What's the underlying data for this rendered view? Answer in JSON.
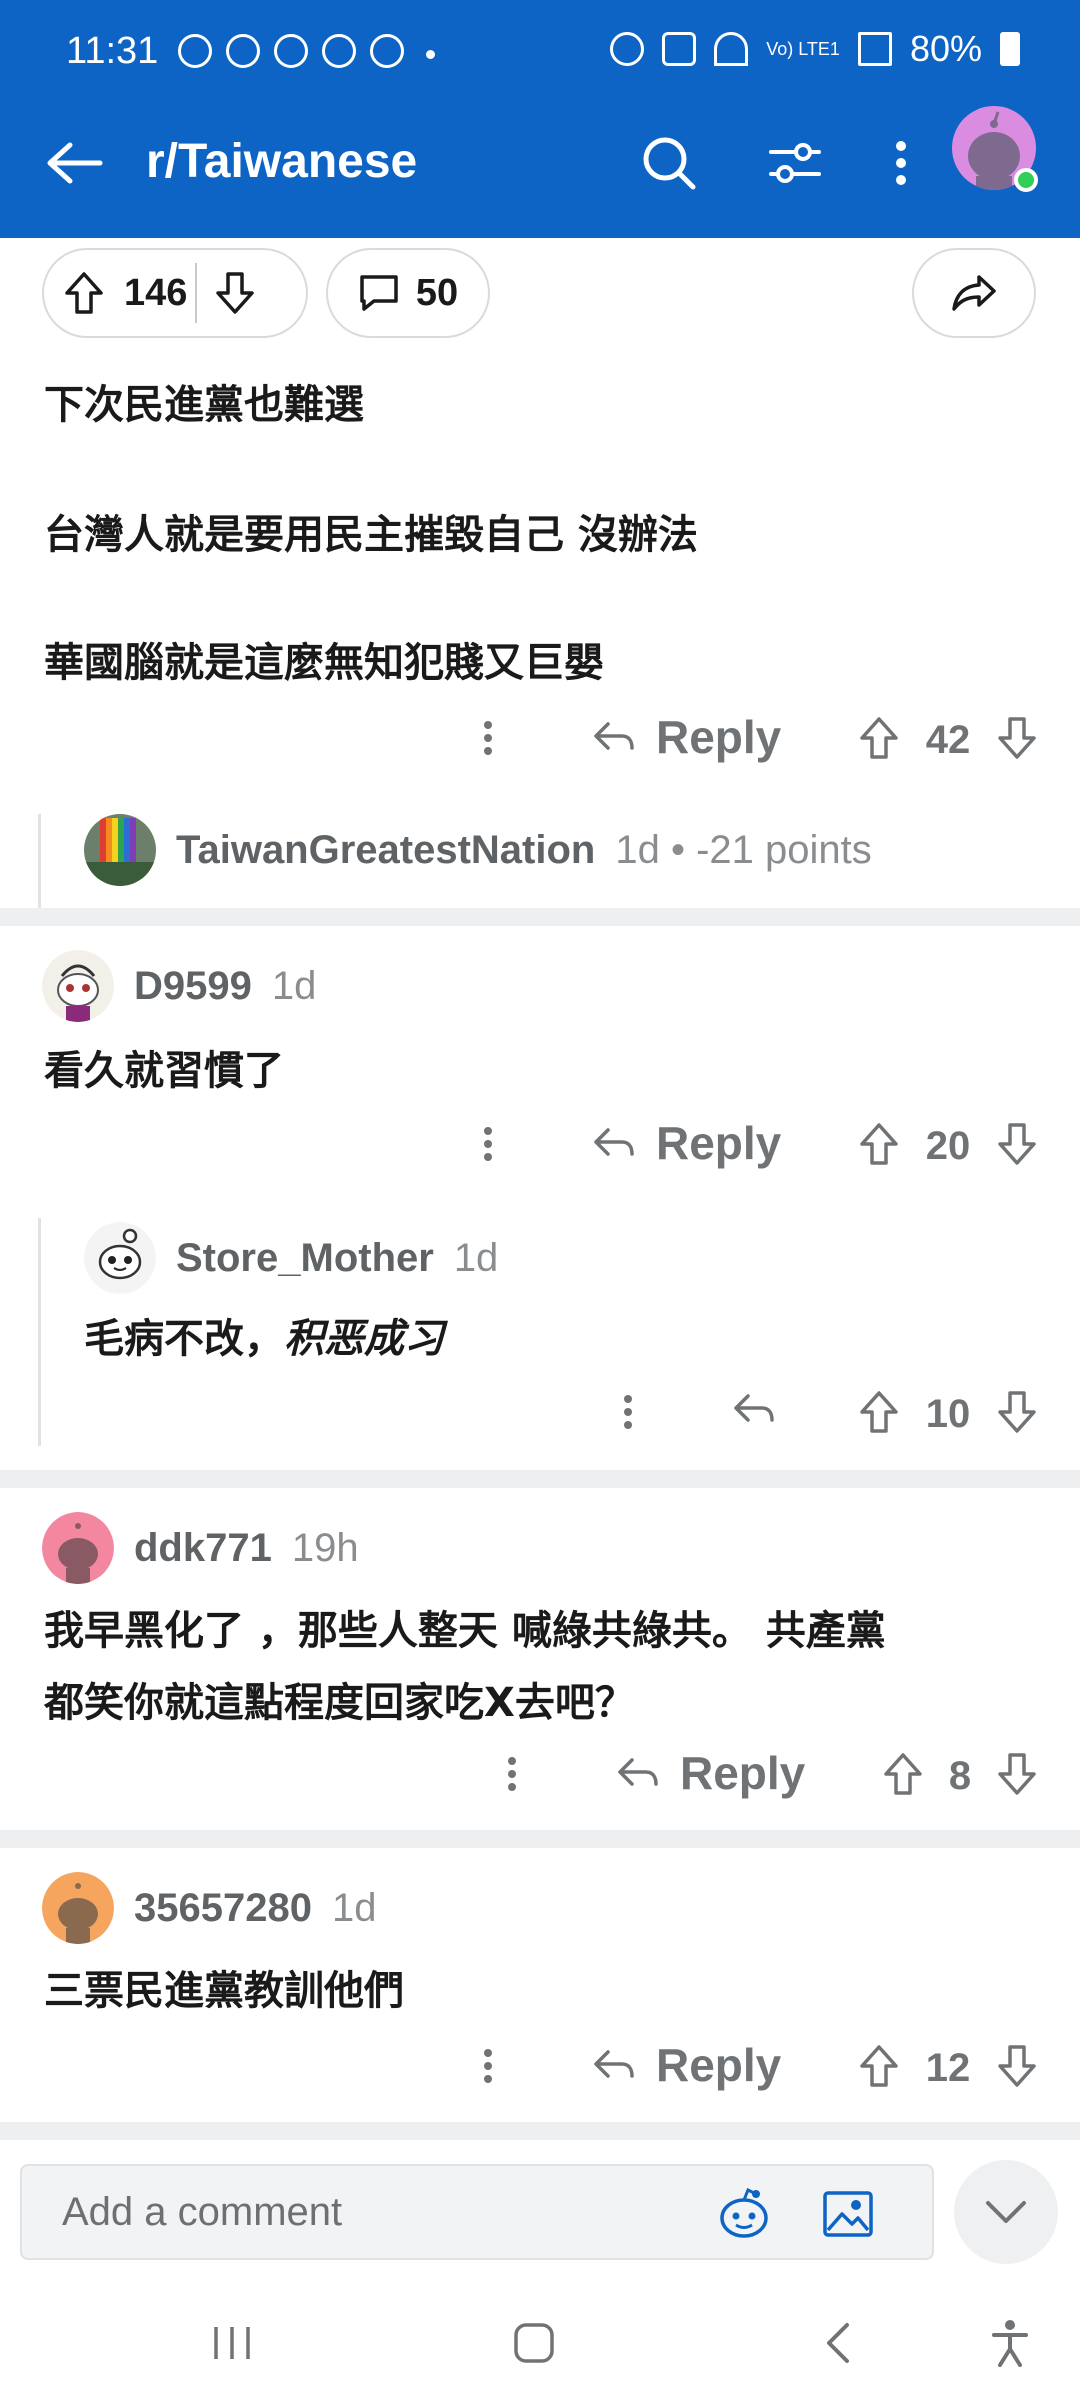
{
  "status": {
    "time": "11:31",
    "battery": "80%",
    "network": "Vo) LTE1"
  },
  "header": {
    "title": "r/Taiwanese"
  },
  "post_actions": {
    "upvotes": "146",
    "comments": "50"
  },
  "post_body": {
    "line1": "下次民進黨也難選",
    "line2": "台灣人就是要用民主摧毀自己 沒辦法",
    "line3": "華國腦就是這麼無知犯賤又巨嬰"
  },
  "comment_actions": {
    "reply_label": "Reply"
  },
  "first_score": "42",
  "collapsed_reply": {
    "user": "TaiwanGreatestNation",
    "meta": "1d • -21 points"
  },
  "comments": [
    {
      "user": "D9599",
      "time": "1d",
      "text": "看久就習慣了",
      "score": "20"
    },
    {
      "user": "Store_Mother",
      "time": "1d",
      "text_normal": "毛病不改，",
      "text_italic": "积恶成习",
      "score": "10"
    },
    {
      "user": "ddk771",
      "time": "19h",
      "text_line1": "我早黑化了 ，那些人整天 喊綠共綠共。 共產黨",
      "text_line2": "都笑你就這點程度回家吃X去吧？",
      "score": "8"
    },
    {
      "user": "35657280",
      "time": "1d",
      "text": "三票民進黨教訓他們",
      "score": "12"
    }
  ],
  "composer": {
    "placeholder": "Add a comment"
  },
  "colors": {
    "brand_blue": "#0e64c4",
    "text": "#1a1a1b",
    "muted": "#707375"
  }
}
